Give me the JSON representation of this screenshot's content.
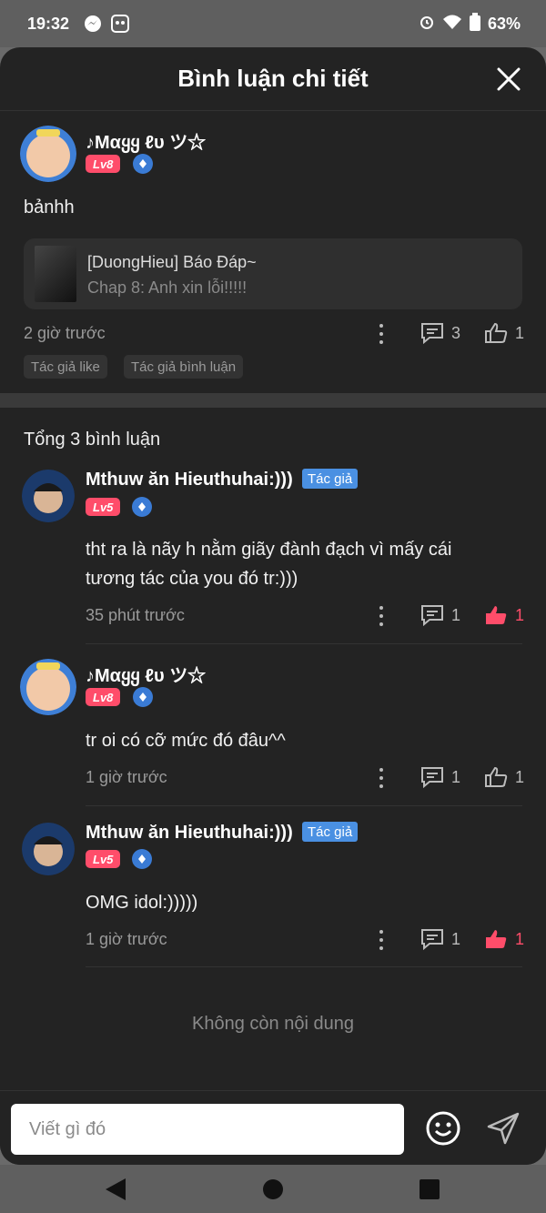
{
  "status": {
    "time": "19:32",
    "battery": "63%"
  },
  "header": {
    "title": "Bình luận chi tiết"
  },
  "main_comment": {
    "name": "♪Mαყყ ℓυ ツ☆",
    "level": "Lv8",
    "text": "bảnhh",
    "ref_title": "[DuongHieu] Báo Đáp~",
    "ref_sub": "Chap 8: Anh xin lỗi!!!!!",
    "time": "2 giờ trước",
    "reply_count": "3",
    "like_count": "1",
    "chips": [
      "Tác giả like",
      "Tác giả bình luận"
    ]
  },
  "total_label": "Tổng 3 bình luận",
  "replies": [
    {
      "name": "Mthuw ăn Hieuthuhai:)))",
      "author_tag": "Tác giả",
      "level": "Lv5",
      "text_line1": "tht ra là nãy h nằm giãy đành đạch vì mấy cái",
      "text_line2": "tương tác của you đó tr:)))",
      "time": "35 phút trước",
      "reply_count": "1",
      "like_count": "1"
    },
    {
      "name": "♪Mαყყ ℓυ ツ☆",
      "level": "Lv8",
      "text": "tr oi có cỡ mức đó đâu^^",
      "time": "1 giờ trước",
      "reply_count": "1",
      "like_count": "1"
    },
    {
      "name": "Mthuw ăn Hieuthuhai:)))",
      "author_tag": "Tác giả",
      "level": "Lv5",
      "text": "OMG idol:)))))",
      "time": "1 giờ trước",
      "reply_count": "1",
      "like_count": "1"
    }
  ],
  "no_more": "Không còn nội dung",
  "input": {
    "placeholder": "Viết gì đó"
  },
  "colors": {
    "accent_like": "#ff4d6a",
    "author_tag": "#4a90e2"
  }
}
